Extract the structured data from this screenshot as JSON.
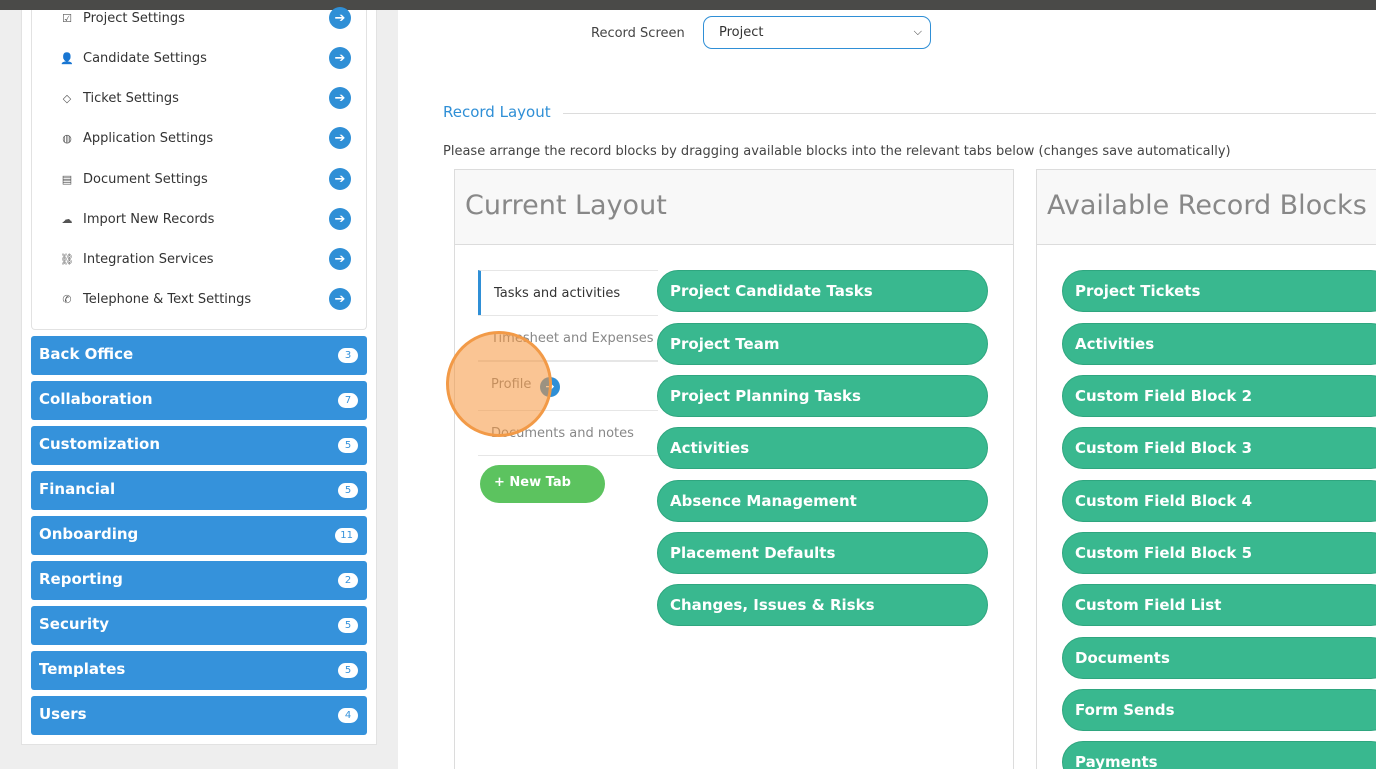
{
  "settings_links": [
    {
      "label": "Project Settings",
      "icon": "checkbox-icon"
    },
    {
      "label": "Candidate Settings",
      "icon": "users-icon"
    },
    {
      "label": "Ticket Settings",
      "icon": "tag-icon"
    },
    {
      "label": "Application Settings",
      "icon": "globe-icon"
    },
    {
      "label": "Document Settings",
      "icon": "document-icon"
    },
    {
      "label": "Import New Records",
      "icon": "upload-cloud-icon"
    },
    {
      "label": "Integration Services",
      "icon": "link-icon"
    },
    {
      "label": "Telephone & Text Settings",
      "icon": "phone-icon"
    }
  ],
  "nav_sections": [
    {
      "label": "Back Office",
      "count": "3"
    },
    {
      "label": "Collaboration",
      "count": "7"
    },
    {
      "label": "Customization",
      "count": "5"
    },
    {
      "label": "Financial",
      "count": "5"
    },
    {
      "label": "Onboarding",
      "count": "11"
    },
    {
      "label": "Reporting",
      "count": "2"
    },
    {
      "label": "Security",
      "count": "5"
    },
    {
      "label": "Templates",
      "count": "5"
    },
    {
      "label": "Users",
      "count": "4"
    }
  ],
  "record_screen": {
    "label": "Record Screen",
    "value": "Project"
  },
  "record_layout": {
    "title": "Record Layout",
    "instructions": "Please arrange the record blocks by dragging available blocks into the relevant tabs below (changes save automatically)"
  },
  "current_layout": {
    "title": "Current Layout",
    "tabs": [
      {
        "label": "Tasks and activities"
      },
      {
        "label": "Timesheet and Expenses"
      },
      {
        "label": "Profile"
      },
      {
        "label": "Documents and notes"
      }
    ],
    "new_tab_label": "+  New Tab",
    "blocks": [
      "Project Candidate Tasks",
      "Project Team",
      "Project Planning Tasks",
      "Activities",
      "Absence Management",
      "Placement Defaults",
      "Changes, Issues & Risks"
    ]
  },
  "available_blocks": {
    "title": "Available Record Blocks",
    "blocks": [
      "Project Tickets",
      "Activities",
      "Custom Field Block 2",
      "Custom Field Block 3",
      "Custom Field Block 4",
      "Custom Field Block 5",
      "Custom Field List",
      "Documents",
      "Form Sends",
      "Payments"
    ]
  },
  "colors": {
    "accent_blue": "#3592db",
    "block_green": "#39b88f",
    "new_tab_green": "#5cc35f",
    "cursor_orange": "#f29a47"
  }
}
